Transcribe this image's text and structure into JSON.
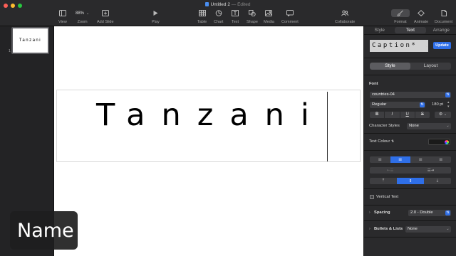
{
  "window": {
    "title": "Untitled 2",
    "separator": "—",
    "edited": "Edited"
  },
  "toolbar": {
    "view": "View",
    "zoom_value": "88%",
    "zoom": "Zoom",
    "add_slide": "Add Slide",
    "play": "Play",
    "table": "Table",
    "chart": "Chart",
    "text": "Text",
    "shape": "Shape",
    "media": "Media",
    "comment": "Comment",
    "collaborate": "Collaborate",
    "format": "Format",
    "animate": "Animate",
    "document": "Document"
  },
  "navigator": {
    "slide_number": "1",
    "thumb_text": "Tanzani"
  },
  "slide": {
    "text": "Tanzani"
  },
  "overlay": {
    "name": "Name"
  },
  "sidebar": {
    "tabs": [
      "Style",
      "Text",
      "Arrange"
    ],
    "paragraph_style": "Caption*",
    "update": "Update",
    "style_layout": [
      "Style",
      "Layout"
    ],
    "font_label": "Font",
    "font_family": "countries-04",
    "typeface": "Regular",
    "font_size": "180 pt",
    "bius": [
      "B",
      "I",
      "U",
      "S"
    ],
    "character_styles_label": "Character Styles",
    "character_styles_value": "None",
    "text_colour_label": "Text Colour",
    "vertical_text_label": "Vertical Text",
    "spacing_label": "Spacing",
    "spacing_value": "2.0 - Double",
    "bullets_label": "Bullets & Lists",
    "bullets_value": "None"
  },
  "colors": {
    "accent": "#2f6fe8",
    "sidebar_bg": "#2a2a2c",
    "canvas_bg": "#ffffff"
  }
}
